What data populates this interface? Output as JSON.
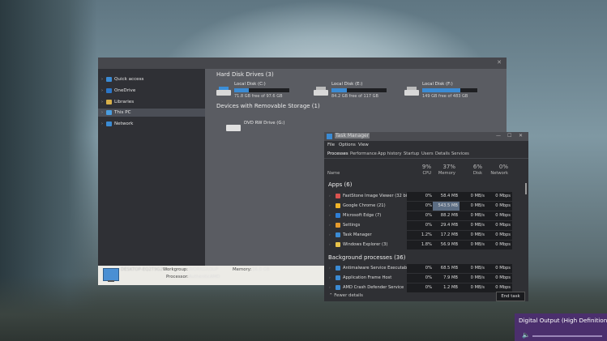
{
  "explorer": {
    "nav": [
      {
        "label": "Quick access"
      },
      {
        "label": "OneDrive"
      },
      {
        "label": "Libraries"
      },
      {
        "label": "This PC"
      },
      {
        "label": "Network"
      }
    ],
    "hard_disk_title": "Hard Disk Drives (3)",
    "drives": [
      {
        "name": "Local Disk (C:)",
        "free": "71.8 GB free of 97.6 GB",
        "used_fraction": 0.26
      },
      {
        "name": "Local Disk (E:)",
        "free": "84.2 GB free of 117 GB",
        "used_fraction": 0.28
      },
      {
        "name": "Local Disk (F:)",
        "free": "149 GB free of 483 GB",
        "used_fraction": 0.69
      }
    ],
    "removable_title": "Devices with Removable Storage (1)",
    "dvd": {
      "name": "DVD RW Drive (G:)"
    },
    "details": {
      "computer_name": "DESKTOP-EQ2T9G2",
      "workgroup_label": "Workgroup:",
      "workgroup_value": "WORKGROUP",
      "memory_label": "Memory:",
      "memory_value": "16.0 GB",
      "processor_label": "Processor:",
      "processor_value": "AuthenticAMD"
    }
  },
  "taskmgr": {
    "title": "Task Manager",
    "menu": [
      "File",
      "Options",
      "View"
    ],
    "tabs": [
      "Processes",
      "Performance",
      "App history",
      "Startup",
      "Users",
      "Details",
      "Services"
    ],
    "header": {
      "name": "Name",
      "cpu_pct": "9%",
      "cpu": "CPU",
      "mem_pct": "37%",
      "mem": "Memory",
      "disk_pct": "6%",
      "disk": "Disk",
      "net_pct": "0%",
      "net": "Network"
    },
    "apps_title": "Apps (6)",
    "apps": [
      {
        "name": "FastStone Image Viewer (32 bit)",
        "cpu": "0%",
        "mem": "58.4 MB",
        "disk": "0 MB/s",
        "net": "0 Mbps",
        "icon_color": "#d9534f"
      },
      {
        "name": "Google Chrome (21)",
        "cpu": "0%",
        "mem": "543.5 MB",
        "disk": "0 MB/s",
        "net": "0 Mbps",
        "icon_color": "#f0b429"
      },
      {
        "name": "Microsoft Edge (7)",
        "cpu": "0%",
        "mem": "88.2 MB",
        "disk": "0 MB/s",
        "net": "0 Mbps",
        "icon_color": "#2f7fd6"
      },
      {
        "name": "Settings",
        "cpu": "0%",
        "mem": "29.4 MB",
        "disk": "0 MB/s",
        "net": "0 Mbps",
        "icon_color": "#e39a2d"
      },
      {
        "name": "Task Manager",
        "cpu": "1.2%",
        "mem": "17.2 MB",
        "disk": "0 MB/s",
        "net": "0 Mbps",
        "icon_color": "#3b8bd4"
      },
      {
        "name": "Windows Explorer (3)",
        "cpu": "1.8%",
        "mem": "56.9 MB",
        "disk": "0 MB/s",
        "net": "0 Mbps",
        "icon_color": "#e7c24a"
      }
    ],
    "bg_title": "Background processes (36)",
    "bg": [
      {
        "name": "Antimalware Service Executable",
        "cpu": "0%",
        "mem": "68.5 MB",
        "disk": "0 MB/s",
        "net": "0 Mbps",
        "icon_color": "#3b8bd4"
      },
      {
        "name": "Application Frame Host",
        "cpu": "0%",
        "mem": "7.9 MB",
        "disk": "0 MB/s",
        "net": "0 Mbps",
        "icon_color": "#3b8bd4"
      },
      {
        "name": "AMD Crash Defender Service",
        "cpu": "0%",
        "mem": "1.2 MB",
        "disk": "0 MB/s",
        "net": "0 Mbps",
        "icon_color": "#3b8bd4"
      }
    ],
    "fewer_details": "Fewer details",
    "end_task": "End task"
  },
  "audio": {
    "label": "Digital Output (High Definition Audio"
  }
}
